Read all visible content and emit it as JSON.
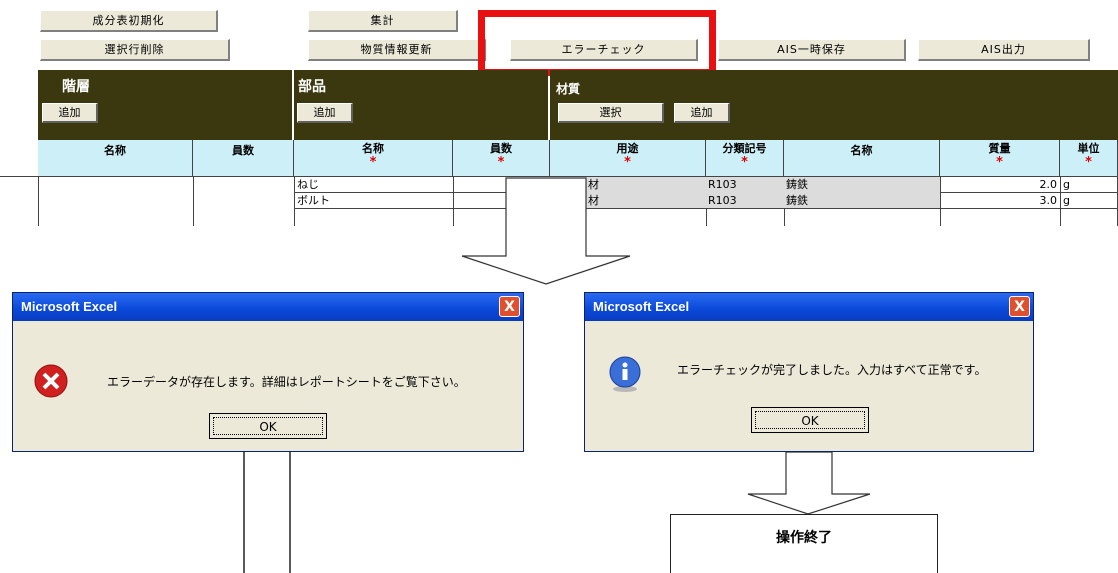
{
  "toolbar": {
    "init_label": "成分表初期化",
    "delete_row_label": "選択行削除",
    "aggregate_label": "集計",
    "update_label": "物質情報更新",
    "error_check_label": "エラーチェック",
    "ais_temp_label": "AIS一時保存",
    "ais_output_label": "AIS出力"
  },
  "sections": {
    "layer": {
      "title": "階層",
      "add_label": "追加"
    },
    "parts": {
      "title": "部品",
      "add_label": "追加"
    },
    "material": {
      "title": "材質",
      "select_label": "選択",
      "add_label": "追加"
    }
  },
  "columns": {
    "layer_name": "名称",
    "layer_count": "員数",
    "part_name": "名称",
    "part_count": "員数",
    "usage": "用途",
    "class_code": "分類記号",
    "mat_name": "名称",
    "mass": "質量",
    "unit": "単位",
    "required_mark": "*"
  },
  "rows": [
    {
      "part_name": "ねじ",
      "usage": "材",
      "code": "R103",
      "mat_name": "鋳鉄",
      "mass": "2.0",
      "unit": "g"
    },
    {
      "part_name": "ボルト",
      "usage": "材",
      "code": "R103",
      "mat_name": "鋳鉄",
      "mass": "3.0",
      "unit": "g"
    }
  ],
  "dialog_error": {
    "title": "Microsoft Excel",
    "message": "エラーデータが存在します。詳細はレポートシートをご覧下さい。",
    "ok_label": "OK",
    "close_label": "X"
  },
  "dialog_info": {
    "title": "Microsoft Excel",
    "message": "エラーチェックが完了しました。入力はすべて正常です。",
    "ok_label": "OK",
    "close_label": "X"
  },
  "end_box": {
    "label": "操作終了"
  },
  "colors": {
    "highlight": "#e81010",
    "header_dark": "#3b3810",
    "header_light": "#cdf0f8"
  }
}
